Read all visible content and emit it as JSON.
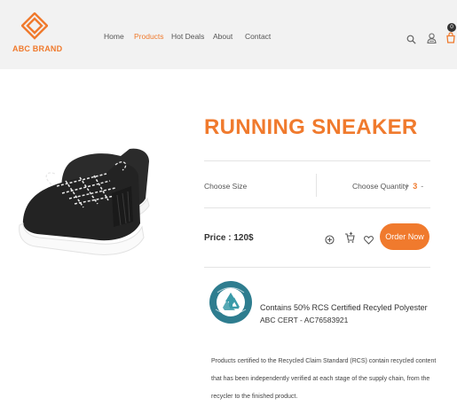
{
  "brand": {
    "name": "ABC BRAND",
    "accent_color": "#f07a2d"
  },
  "nav": {
    "items": [
      {
        "label": "Home",
        "active": false
      },
      {
        "label": "Products",
        "active": true
      },
      {
        "label": "Hot Deals",
        "active": false
      },
      {
        "label": "About",
        "active": false
      },
      {
        "label": "Contact",
        "active": false
      }
    ]
  },
  "header_icons": {
    "search": "search-icon",
    "user": "user-icon",
    "cart": "cart-icon",
    "cart_count": "0"
  },
  "product": {
    "title": "RUNNING SNEAKER",
    "choose_size_label": "Choose Size",
    "choose_quantity_label": "Choose Quantity",
    "quantity_plus": "+",
    "quantity": "3",
    "quantity_minus": "-",
    "price": "Price : 120$",
    "action_icons": [
      "compare-icon",
      "add-to-cart-icon",
      "wishlist-heart-icon"
    ],
    "order_button": "Order Now"
  },
  "certification": {
    "badge_icon": "recycled-claim-standard-badge",
    "headline": "Contains 50% RCS Certified Recyled Polyester",
    "cert_id": "ABC CERT - AC76583921",
    "description_lines": [
      "Products certified to the Recycled Claim Standard (RCS) contain recycled content",
      "that has been independently verified at each stage of the supply chain, from the",
      "recycler to the finished product."
    ]
  }
}
